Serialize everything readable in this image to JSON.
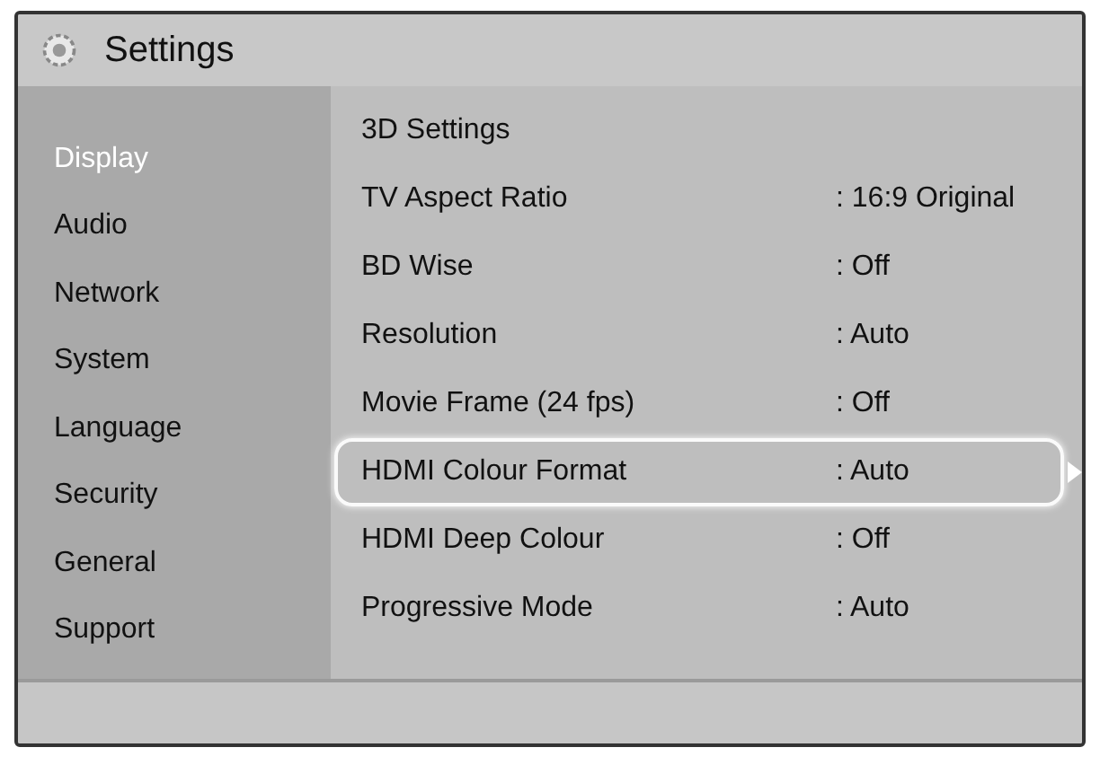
{
  "header": {
    "title": "Settings"
  },
  "sidebar": {
    "items": [
      {
        "label": "Display",
        "selected": true
      },
      {
        "label": "Audio",
        "selected": false
      },
      {
        "label": "Network",
        "selected": false
      },
      {
        "label": "System",
        "selected": false
      },
      {
        "label": "Language",
        "selected": false
      },
      {
        "label": "Security",
        "selected": false
      },
      {
        "label": "General",
        "selected": false
      },
      {
        "label": "Support",
        "selected": false
      }
    ]
  },
  "settings": [
    {
      "label": "3D Settings",
      "selected": false
    },
    {
      "label": "TV Aspect Ratio",
      "value": ": 16:9 Original",
      "selected": false
    },
    {
      "label": "BD Wise",
      "value": ": Off",
      "selected": false
    },
    {
      "label": "Resolution",
      "value": ": Auto",
      "selected": false
    },
    {
      "label": "Movie Frame (24 fps)",
      "value": ": Off",
      "selected": false
    },
    {
      "label": "HDMI Colour Format",
      "value": ": Auto",
      "selected": true
    },
    {
      "label": "HDMI Deep Colour",
      "value": ": Off",
      "selected": false
    },
    {
      "label": "Progressive Mode",
      "value": ": Auto",
      "selected": false
    }
  ]
}
